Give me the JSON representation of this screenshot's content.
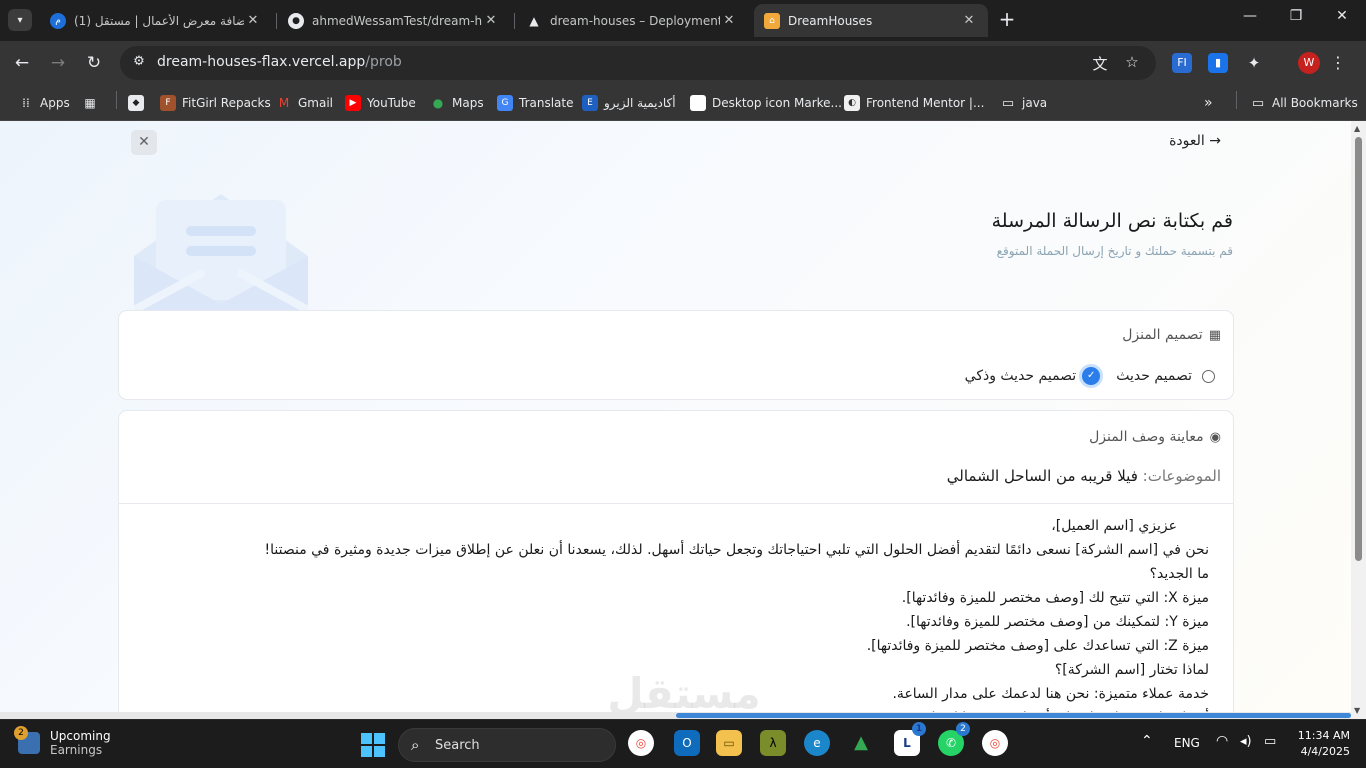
{
  "browser": {
    "tabs": [
      {
        "title": "(1) إضافة معرض الأعمال | مستقل",
        "favicon": "mostaql-icon"
      },
      {
        "title": "ahmedWessamTest/dream-houses",
        "favicon": "github-icon"
      },
      {
        "title": "dream-houses – Deployment Overview",
        "favicon": "vercel-icon"
      },
      {
        "title": "DreamHouses",
        "favicon": "dreamhouses-icon"
      }
    ],
    "url_host": "dream-houses-flax.vercel.app",
    "url_path": "/prob",
    "profile_initial": "W",
    "bookmarks": [
      "Apps",
      "FitGirl Repacks",
      "Gmail",
      "YouTube",
      "Maps",
      "Translate",
      "أكاديمية الزيرو",
      "Desktop icon Marke...",
      "Frontend Mentor |...",
      "java",
      "All Bookmarks"
    ]
  },
  "page": {
    "back_label": "العودة",
    "title": "قم بكتابة نص الرسالة المرسلة",
    "subtitle": "قم بتسمية حملتك و تاريخ إرسال الحملة المتوقع",
    "design_card": {
      "heading": "تصميم المنزل",
      "options": [
        {
          "label": "تصميم حديث",
          "selected": false
        },
        {
          "label": "تصميم حديث وذكي",
          "selected": true
        }
      ]
    },
    "preview_card": {
      "heading": "معاينة وصف المنزل",
      "topics_label": "الموضوعات:",
      "topics_value": "فيلا قريبه من الساحل الشمالي",
      "letter_lines": [
        "عزيزي [اسم العميل]،",
        "نحن في [اسم الشركة] نسعى دائمًا لتقديم أفضل الحلول التي تلبي احتياجاتك وتجعل حياتك أسهل. لذلك، يسعدنا أن نعلن عن إطلاق ميزات جديدة ومثيرة في منصتنا!",
        "ما الجديد؟",
        "ميزة X: التي تتيح لك [وصف مختصر للميزة وفائدتها].",
        "ميزة Y: لتمكينك من [وصف مختصر للميزة وفائدتها].",
        "ميزة Z: التي تساعدك على [وصف مختصر للميزة وفائدتها].",
        "لماذا تختار [اسم الشركة]؟",
        "خدمة عملاء متميزة: نحن هنا لدعمك على مدار الساعة.",
        "أسعار تنافسية: احصل على أفضل قيمة مقابل ما تدفعه."
      ]
    },
    "watermark": "مستقل"
  },
  "taskbar": {
    "weather_title": "Upcoming",
    "weather_sub": "Earnings",
    "weather_badge": "2",
    "search_label": "Search",
    "lang": "ENG",
    "time": "11:34 AM",
    "date": "4/4/2025",
    "whatsapp_badge": "2",
    "lexicon_badge": "1"
  }
}
